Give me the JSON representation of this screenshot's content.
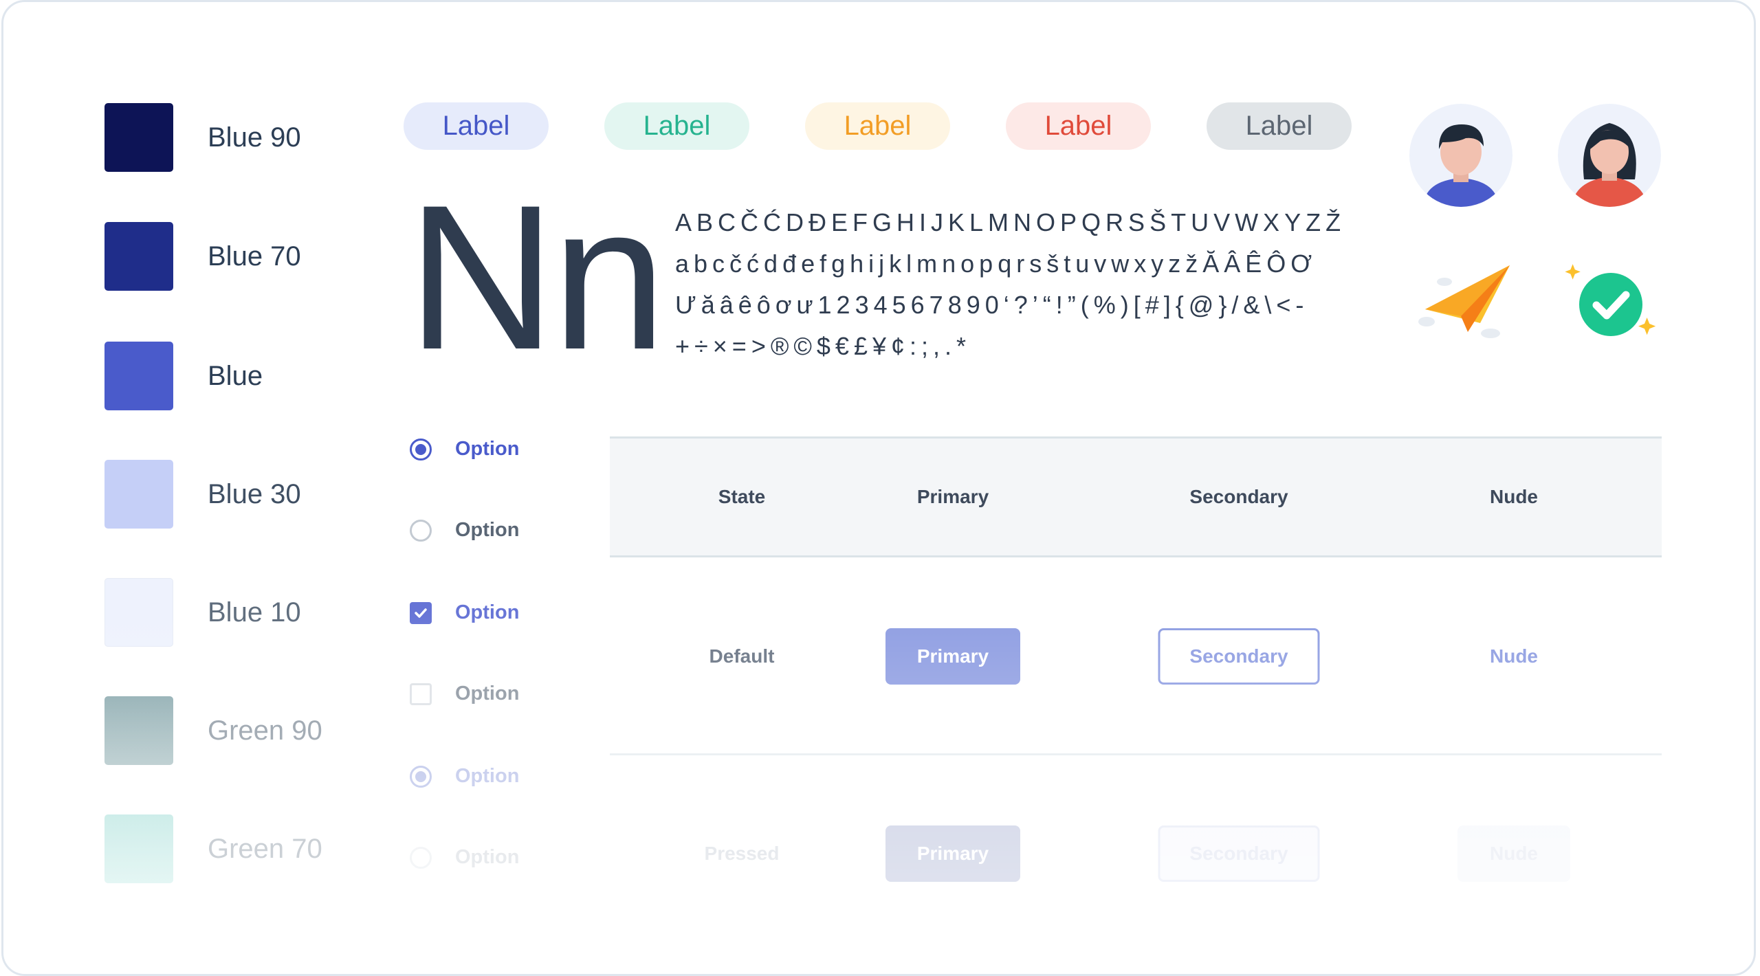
{
  "swatches": [
    {
      "name": "Blue 90",
      "color": "#0d1456"
    },
    {
      "name": "Blue 70",
      "color": "#1f2d8a"
    },
    {
      "name": "Blue",
      "color": "#4a5bcb"
    },
    {
      "name": "Blue 30",
      "color": "#c5cff7"
    },
    {
      "name": "Blue 10",
      "color": "#eef2fd"
    },
    {
      "name": "Green 90",
      "color": "#8aa9ae"
    },
    {
      "name": "Green 70",
      "color": "#b3e3de"
    }
  ],
  "labels": [
    {
      "text": "Label",
      "bg": "#e6ebfb",
      "fg": "#4557c7"
    },
    {
      "text": "Label",
      "bg": "#e3f6f1",
      "fg": "#26b38f"
    },
    {
      "text": "Label",
      "bg": "#fef5e3",
      "fg": "#f29d25"
    },
    {
      "text": "Label",
      "bg": "#fde9e7",
      "fg": "#e04a3a"
    },
    {
      "text": "Label",
      "bg": "#e1e5e8",
      "fg": "#5c6672"
    }
  ],
  "typography": {
    "sample": "Nn",
    "lines": [
      "ABCČĆDĐEFGHIJKLMNOPQRSŠTUVWXYZŽ",
      "abcčćdđefghijklmnopqrsštuvwxyzžĂÂÊÔƠ",
      "Ưăâêôơư1234567890‘?’“!”(%)[#]{@}/&\\<-",
      "+÷×=>®©$€£¥¢:;,.*"
    ]
  },
  "avatars": {
    "male": "avatar-male-icon",
    "female": "avatar-female-icon"
  },
  "illustrations": {
    "plane": "paper-plane-icon",
    "success": "check-circle-icon"
  },
  "options": [
    {
      "label": "Option",
      "control": "radio",
      "checked": true,
      "label_color": "#4a5bcb",
      "border": "#4a5bcb",
      "opacity": 1
    },
    {
      "label": "Option",
      "control": "radio",
      "checked": false,
      "label_color": "#5a6675",
      "border": "#c3cad2",
      "opacity": 1
    },
    {
      "label": "Option",
      "control": "checkbox",
      "checked": true,
      "label_color": "#6674d6",
      "border": "#6674d6",
      "opacity": 1
    },
    {
      "label": "Option",
      "control": "checkbox",
      "checked": false,
      "label_color": "#6e7986",
      "border": "#d5dae0",
      "opacity": 0.8
    },
    {
      "label": "Option",
      "control": "radio",
      "checked": true,
      "label_color": "#b6bfe8",
      "border": "#b6bfe8",
      "opacity": 1
    },
    {
      "label": "Option",
      "control": "radio",
      "checked": false,
      "label_color": "#c8ced5",
      "border": "#e4e8ec",
      "opacity": 0.7
    }
  ],
  "table": {
    "headers": [
      "State",
      "Primary",
      "Secondary",
      "Nude"
    ],
    "rows": [
      {
        "state": "Default",
        "primary": "Primary",
        "secondary": "Secondary",
        "nude": "Nude"
      },
      {
        "state": "Pressed",
        "primary": "Primary",
        "secondary": "Secondary",
        "nude": "Nude"
      }
    ]
  }
}
